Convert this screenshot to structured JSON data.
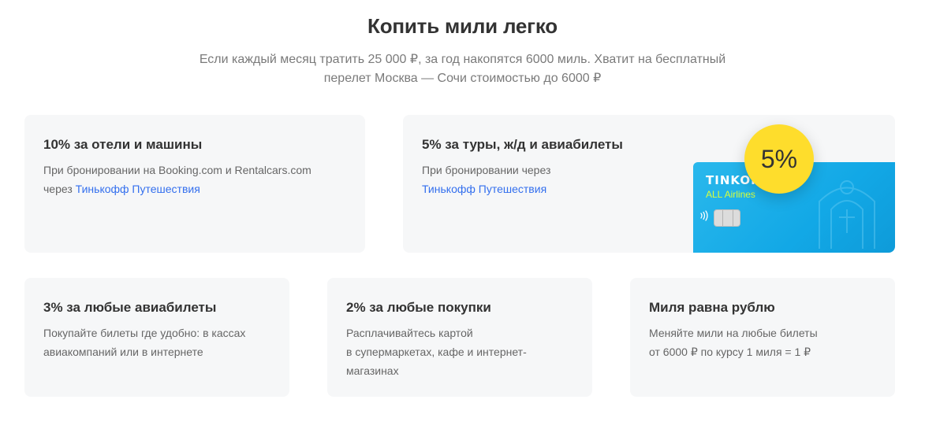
{
  "header": {
    "title": "Копить мили легко",
    "subtitle_line1": "Если каждый месяц тратить 25 000 ₽, за год накопятся 6000 миль. Хватит на бесплатный",
    "subtitle_line2": "перелет Москва — Сочи стоимостью до 6000 ₽"
  },
  "cards": [
    {
      "title": "10% за отели и машины",
      "line1": "При бронировании на Booking.com и Rentalcars.com",
      "line2_prefix": "через ",
      "line2_link": "Тинькофф Путешествия"
    },
    {
      "title": "5% за туры, ж/д и авиабилеты",
      "line1": "При бронировании через",
      "line2_link": "Тинькофф Путешествия",
      "badge": "5%",
      "bank_card": {
        "name": "TINKOFF",
        "tag": "ALL Airlines"
      }
    },
    {
      "title": "3% за любые авиабилеты",
      "line1": "Покупайте билеты где удобно: в кассах",
      "line2": "авиакомпаний или в интернете"
    },
    {
      "title": "2% за любые покупки",
      "line1": "Расплачивайтесь картой",
      "line2": "в супермаркетах, кафе и интернет-",
      "line3": "магазинах"
    },
    {
      "title": "Миля равна рублю",
      "line1": "Меняйте мили на любые билеты",
      "line2": "от 6000 ₽ по курсу 1 миля = 1 ₽"
    }
  ],
  "colors": {
    "link": "#336fee",
    "card_bg": "#f6f7f8",
    "badge": "#fedd2c",
    "bank_card": "#1caee8",
    "bank_tag": "#d9ff3a"
  }
}
